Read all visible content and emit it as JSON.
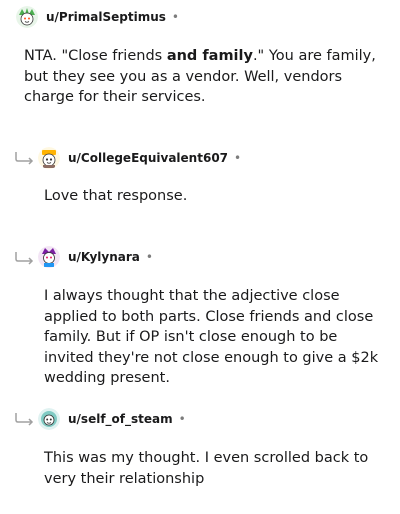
{
  "comments": [
    {
      "username": "u/PrimalSeptimus",
      "dot": "•",
      "body_before": "NTA. \"Close friends ",
      "body_bold": "and family",
      "body_after": ".\" You are family, but they see you as a vendor. Well, vendors charge for their services."
    },
    {
      "username": "u/CollegeEquivalent607",
      "dot": "•",
      "body": "Love that response."
    },
    {
      "username": "u/Kylynara",
      "dot": "•",
      "body": "I always thought that the adjective close applied to both parts. Close friends and close family. But if OP isn't close enough to be invited they're not close enough to give a $2k wedding present."
    },
    {
      "username": "u/self_of_steam",
      "dot": "•",
      "body": "This was my thought. I even scrolled back to very their relationship"
    }
  ],
  "colors": {
    "text": "#1a1a1b",
    "meta": "#7c7c7c",
    "reply_arrow": "#a0a0a0"
  },
  "icons": {
    "avatar": "snoo-avatar-icon",
    "reply": "reply-arrow-icon"
  }
}
